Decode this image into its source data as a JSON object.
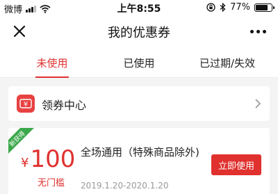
{
  "status_bar": {
    "carrier": "微博",
    "time": "上午8:55",
    "battery_text": "77%",
    "battery_level": 0.77
  },
  "nav": {
    "title": "我的优惠券"
  },
  "tabs": [
    {
      "label": "未使用",
      "active": true
    },
    {
      "label": "已使用",
      "active": false
    },
    {
      "label": "已过期/失效",
      "active": false
    }
  ],
  "coupon_center": {
    "label": "领券中心",
    "icon_glyph": "¥"
  },
  "coupon": {
    "badge": "新获得",
    "currency": "¥",
    "amount": "100",
    "threshold": "无门槛",
    "title": "全场通用（特殊商品除外)",
    "validity": "2019.1.20-2020.1.20",
    "button_label": "立即使用"
  },
  "colors": {
    "accent": "#e0312f",
    "badge": "#3aa84a",
    "background": "#f4f4f4"
  }
}
